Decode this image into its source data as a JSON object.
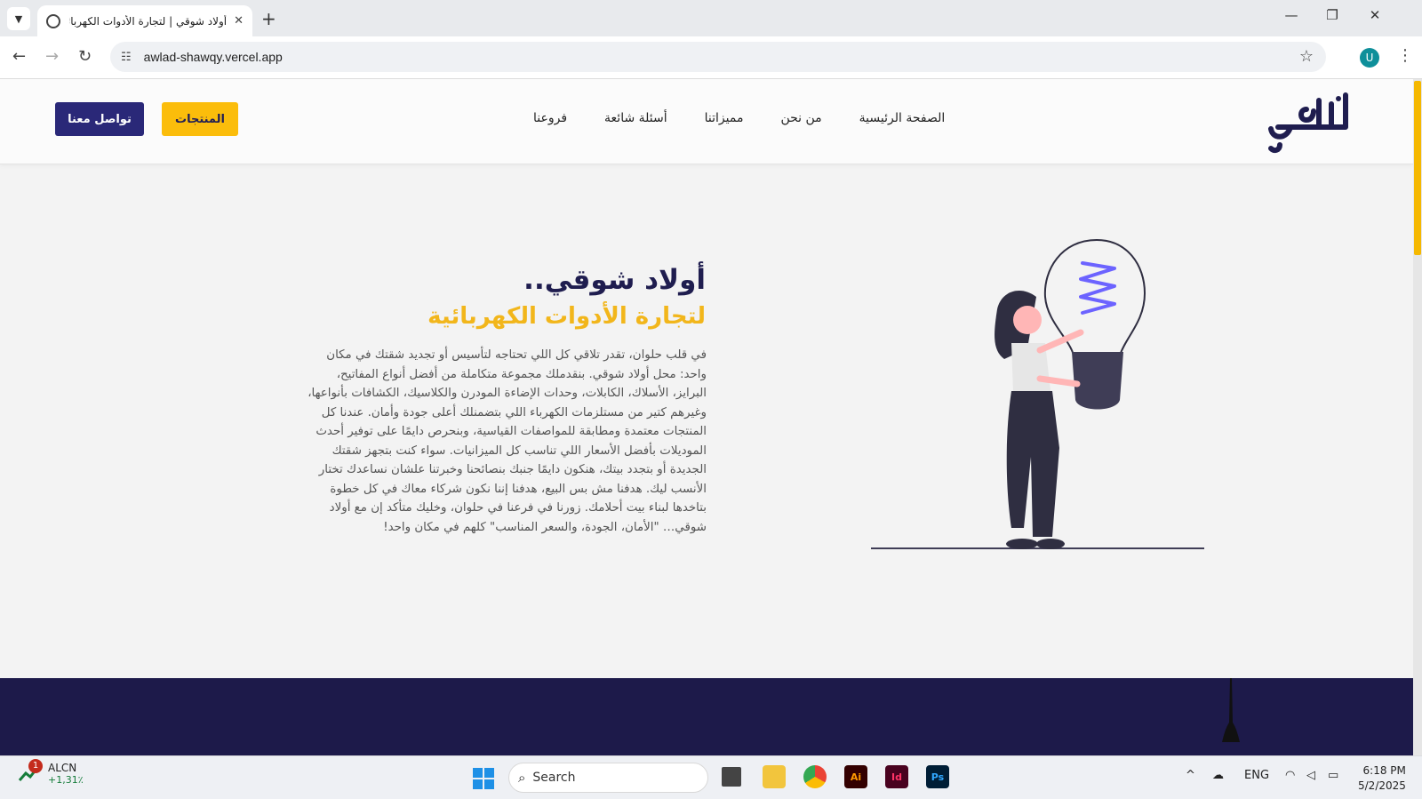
{
  "browser": {
    "tab_title": "أولاد شوقي | لتجارة الأدوات الكهربائية",
    "new_tab": "+",
    "tab_close": "✕",
    "url": "awlad-shawqy.vercel.app",
    "profile_initial": "U",
    "window_controls": {
      "minimize": "—",
      "restore": "❐",
      "close": "✕"
    }
  },
  "site": {
    "brand_color": "#2a2878",
    "accent_color": "#fbbd0b",
    "nav": [
      "الصفحة الرئيسية",
      "من نحن",
      "مميزاتنا",
      "أسئلة شائعة",
      "فروعنا"
    ],
    "buttons": {
      "products": "المنتجات",
      "contact": "تواصل معنا"
    },
    "hero": {
      "title": "أولاد شوقي..",
      "subtitle": "لتجارة الأدوات الكهربائية",
      "paragraph": "في قلب حلوان، تقدر تلاقي كل اللي تحتاجه لتأسيس أو تجديد شقتك في مكان واحد: محل أولاد شوقي. بنقدملك مجموعة متكاملة من أفضل أنواع المفاتيح، البرايز، الأسلاك، الكابلات، وحدات الإضاءة المودرن والكلاسيك، الكشافات بأنواعها، وغيرهم كتير من مستلزمات الكهرباء اللي بتضمنلك أعلى جودة وأمان. عندنا كل المنتجات معتمدة ومطابقة للمواصفات القياسية، وبنحرص دايمًا على توفير أحدث الموديلات بأفضل الأسعار اللي تناسب كل الميزانيات. سواء كنت بتجهز شقتك الجديدة أو بتجدد بيتك، هنكون دايمًا جنبك بنصائحنا وخبرتنا علشان نساعدك تختار الأنسب ليك. هدفنا مش بس البيع، هدفنا إننا نكون شركاء معاك في كل خطوة بتاخدها لبناء بيت أحلامك. زورنا في فرعنا في حلوان، وخليك متأكد إن مع أولاد شوقي… \"الأمان، الجودة، والسعر المناسب\" كلهم في مكان واحد!"
    }
  },
  "taskbar": {
    "stock_name": "ALCN",
    "stock_change": "+1,31٪",
    "stock_badge": "1",
    "search_placeholder": "Search",
    "apps": [
      "Ai",
      "Id",
      "Ps"
    ],
    "language": "ENG",
    "time": "6:18 PM",
    "date": "5/2/2025"
  }
}
